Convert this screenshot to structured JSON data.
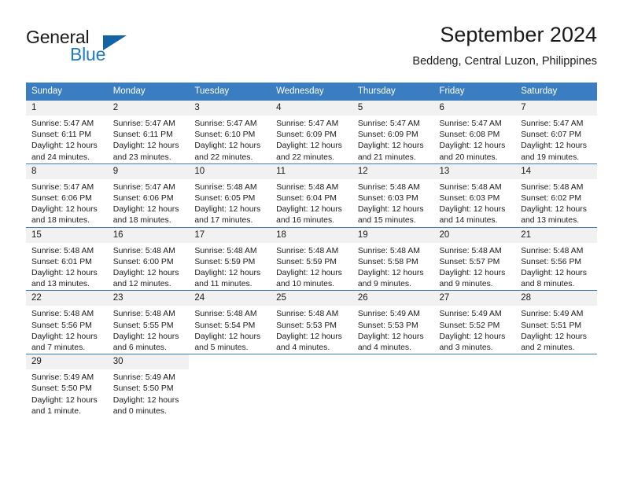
{
  "brand": {
    "name_part1": "General",
    "name_part2": "Blue",
    "triangle_color": "#1464a5",
    "blue_color": "#1f7ac4"
  },
  "header": {
    "title": "September 2024",
    "subtitle": "Beddeng, Central Luzon, Philippines"
  },
  "calendar": {
    "header_bg": "#3a7dc1",
    "daynum_bg": "#f1f1f1",
    "weekdays": [
      "Sunday",
      "Monday",
      "Tuesday",
      "Wednesday",
      "Thursday",
      "Friday",
      "Saturday"
    ],
    "weeks": [
      [
        {
          "day": "1",
          "sunrise": "Sunrise: 5:47 AM",
          "sunset": "Sunset: 6:11 PM",
          "daylight_line1": "Daylight: 12 hours",
          "daylight_line2": "and 24 minutes."
        },
        {
          "day": "2",
          "sunrise": "Sunrise: 5:47 AM",
          "sunset": "Sunset: 6:11 PM",
          "daylight_line1": "Daylight: 12 hours",
          "daylight_line2": "and 23 minutes."
        },
        {
          "day": "3",
          "sunrise": "Sunrise: 5:47 AM",
          "sunset": "Sunset: 6:10 PM",
          "daylight_line1": "Daylight: 12 hours",
          "daylight_line2": "and 22 minutes."
        },
        {
          "day": "4",
          "sunrise": "Sunrise: 5:47 AM",
          "sunset": "Sunset: 6:09 PM",
          "daylight_line1": "Daylight: 12 hours",
          "daylight_line2": "and 22 minutes."
        },
        {
          "day": "5",
          "sunrise": "Sunrise: 5:47 AM",
          "sunset": "Sunset: 6:09 PM",
          "daylight_line1": "Daylight: 12 hours",
          "daylight_line2": "and 21 minutes."
        },
        {
          "day": "6",
          "sunrise": "Sunrise: 5:47 AM",
          "sunset": "Sunset: 6:08 PM",
          "daylight_line1": "Daylight: 12 hours",
          "daylight_line2": "and 20 minutes."
        },
        {
          "day": "7",
          "sunrise": "Sunrise: 5:47 AM",
          "sunset": "Sunset: 6:07 PM",
          "daylight_line1": "Daylight: 12 hours",
          "daylight_line2": "and 19 minutes."
        }
      ],
      [
        {
          "day": "8",
          "sunrise": "Sunrise: 5:47 AM",
          "sunset": "Sunset: 6:06 PM",
          "daylight_line1": "Daylight: 12 hours",
          "daylight_line2": "and 18 minutes."
        },
        {
          "day": "9",
          "sunrise": "Sunrise: 5:47 AM",
          "sunset": "Sunset: 6:06 PM",
          "daylight_line1": "Daylight: 12 hours",
          "daylight_line2": "and 18 minutes."
        },
        {
          "day": "10",
          "sunrise": "Sunrise: 5:48 AM",
          "sunset": "Sunset: 6:05 PM",
          "daylight_line1": "Daylight: 12 hours",
          "daylight_line2": "and 17 minutes."
        },
        {
          "day": "11",
          "sunrise": "Sunrise: 5:48 AM",
          "sunset": "Sunset: 6:04 PM",
          "daylight_line1": "Daylight: 12 hours",
          "daylight_line2": "and 16 minutes."
        },
        {
          "day": "12",
          "sunrise": "Sunrise: 5:48 AM",
          "sunset": "Sunset: 6:03 PM",
          "daylight_line1": "Daylight: 12 hours",
          "daylight_line2": "and 15 minutes."
        },
        {
          "day": "13",
          "sunrise": "Sunrise: 5:48 AM",
          "sunset": "Sunset: 6:03 PM",
          "daylight_line1": "Daylight: 12 hours",
          "daylight_line2": "and 14 minutes."
        },
        {
          "day": "14",
          "sunrise": "Sunrise: 5:48 AM",
          "sunset": "Sunset: 6:02 PM",
          "daylight_line1": "Daylight: 12 hours",
          "daylight_line2": "and 13 minutes."
        }
      ],
      [
        {
          "day": "15",
          "sunrise": "Sunrise: 5:48 AM",
          "sunset": "Sunset: 6:01 PM",
          "daylight_line1": "Daylight: 12 hours",
          "daylight_line2": "and 13 minutes."
        },
        {
          "day": "16",
          "sunrise": "Sunrise: 5:48 AM",
          "sunset": "Sunset: 6:00 PM",
          "daylight_line1": "Daylight: 12 hours",
          "daylight_line2": "and 12 minutes."
        },
        {
          "day": "17",
          "sunrise": "Sunrise: 5:48 AM",
          "sunset": "Sunset: 5:59 PM",
          "daylight_line1": "Daylight: 12 hours",
          "daylight_line2": "and 11 minutes."
        },
        {
          "day": "18",
          "sunrise": "Sunrise: 5:48 AM",
          "sunset": "Sunset: 5:59 PM",
          "daylight_line1": "Daylight: 12 hours",
          "daylight_line2": "and 10 minutes."
        },
        {
          "day": "19",
          "sunrise": "Sunrise: 5:48 AM",
          "sunset": "Sunset: 5:58 PM",
          "daylight_line1": "Daylight: 12 hours",
          "daylight_line2": "and 9 minutes."
        },
        {
          "day": "20",
          "sunrise": "Sunrise: 5:48 AM",
          "sunset": "Sunset: 5:57 PM",
          "daylight_line1": "Daylight: 12 hours",
          "daylight_line2": "and 9 minutes."
        },
        {
          "day": "21",
          "sunrise": "Sunrise: 5:48 AM",
          "sunset": "Sunset: 5:56 PM",
          "daylight_line1": "Daylight: 12 hours",
          "daylight_line2": "and 8 minutes."
        }
      ],
      [
        {
          "day": "22",
          "sunrise": "Sunrise: 5:48 AM",
          "sunset": "Sunset: 5:56 PM",
          "daylight_line1": "Daylight: 12 hours",
          "daylight_line2": "and 7 minutes."
        },
        {
          "day": "23",
          "sunrise": "Sunrise: 5:48 AM",
          "sunset": "Sunset: 5:55 PM",
          "daylight_line1": "Daylight: 12 hours",
          "daylight_line2": "and 6 minutes."
        },
        {
          "day": "24",
          "sunrise": "Sunrise: 5:48 AM",
          "sunset": "Sunset: 5:54 PM",
          "daylight_line1": "Daylight: 12 hours",
          "daylight_line2": "and 5 minutes."
        },
        {
          "day": "25",
          "sunrise": "Sunrise: 5:48 AM",
          "sunset": "Sunset: 5:53 PM",
          "daylight_line1": "Daylight: 12 hours",
          "daylight_line2": "and 4 minutes."
        },
        {
          "day": "26",
          "sunrise": "Sunrise: 5:49 AM",
          "sunset": "Sunset: 5:53 PM",
          "daylight_line1": "Daylight: 12 hours",
          "daylight_line2": "and 4 minutes."
        },
        {
          "day": "27",
          "sunrise": "Sunrise: 5:49 AM",
          "sunset": "Sunset: 5:52 PM",
          "daylight_line1": "Daylight: 12 hours",
          "daylight_line2": "and 3 minutes."
        },
        {
          "day": "28",
          "sunrise": "Sunrise: 5:49 AM",
          "sunset": "Sunset: 5:51 PM",
          "daylight_line1": "Daylight: 12 hours",
          "daylight_line2": "and 2 minutes."
        }
      ],
      [
        {
          "day": "29",
          "sunrise": "Sunrise: 5:49 AM",
          "sunset": "Sunset: 5:50 PM",
          "daylight_line1": "Daylight: 12 hours",
          "daylight_line2": "and 1 minute."
        },
        {
          "day": "30",
          "sunrise": "Sunrise: 5:49 AM",
          "sunset": "Sunset: 5:50 PM",
          "daylight_line1": "Daylight: 12 hours",
          "daylight_line2": "and 0 minutes."
        },
        {
          "day": "",
          "sunrise": "",
          "sunset": "",
          "daylight_line1": "",
          "daylight_line2": ""
        },
        {
          "day": "",
          "sunrise": "",
          "sunset": "",
          "daylight_line1": "",
          "daylight_line2": ""
        },
        {
          "day": "",
          "sunrise": "",
          "sunset": "",
          "daylight_line1": "",
          "daylight_line2": ""
        },
        {
          "day": "",
          "sunrise": "",
          "sunset": "",
          "daylight_line1": "",
          "daylight_line2": ""
        },
        {
          "day": "",
          "sunrise": "",
          "sunset": "",
          "daylight_line1": "",
          "daylight_line2": ""
        }
      ]
    ]
  }
}
